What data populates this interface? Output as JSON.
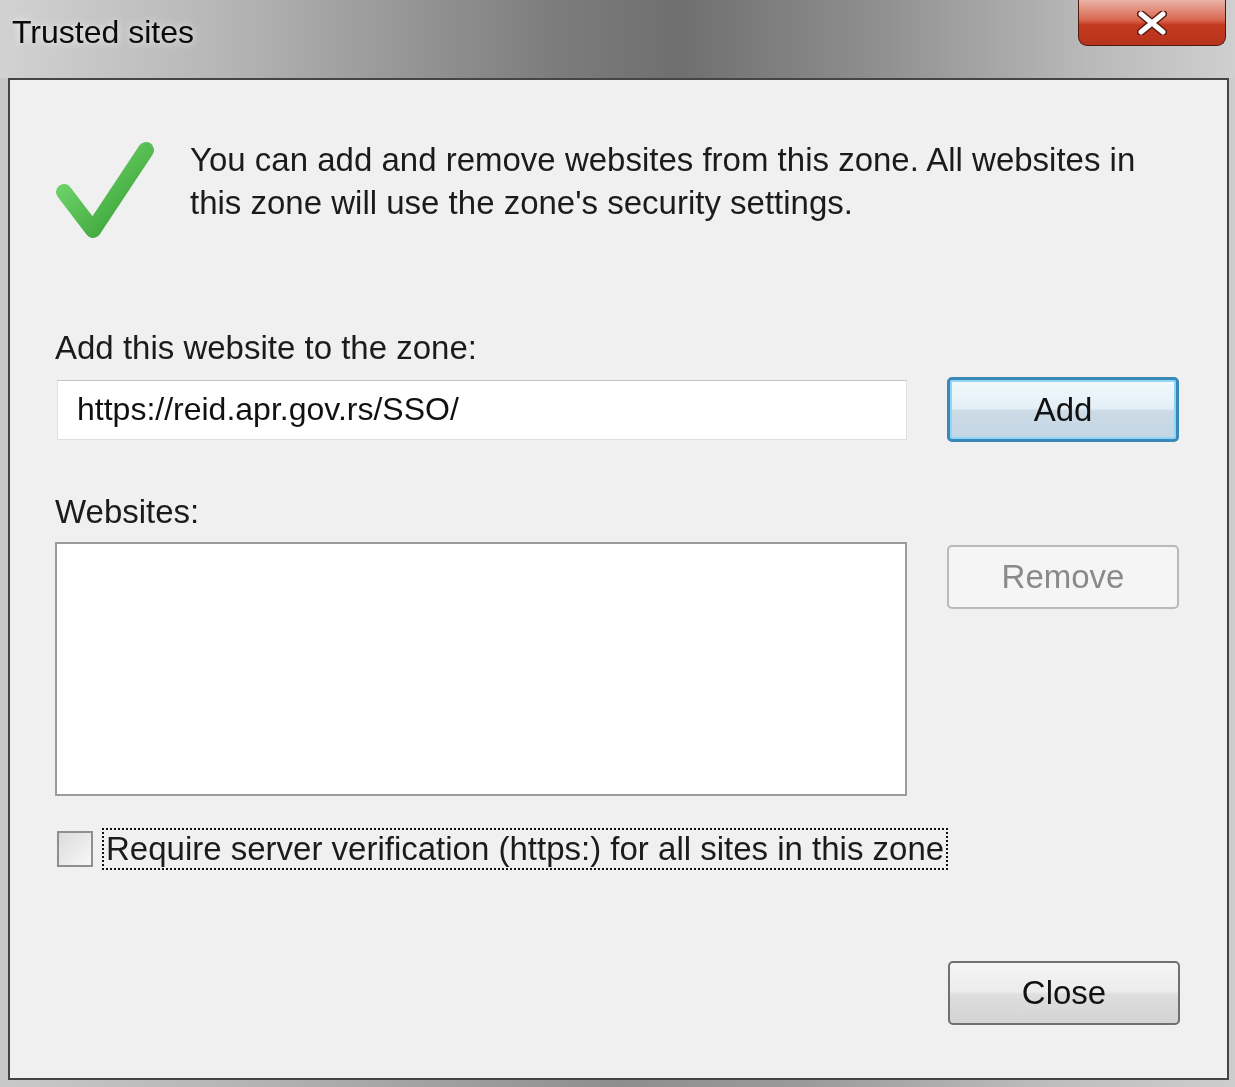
{
  "window": {
    "title": "Trusted sites"
  },
  "message": "You can add and remove websites from this zone. All websites in this zone will use the zone's security settings.",
  "add_site": {
    "label": "Add this website to the zone:",
    "value": "https://reid.apr.gov.rs/SSO/",
    "button": {
      "label": "Add",
      "default": true,
      "disabled": false
    }
  },
  "websites": {
    "label": "Websites:",
    "button": {
      "label": "Remove",
      "default": false,
      "disabled": true
    }
  },
  "require_https": {
    "label": "Require server verification (https:) for all sites in this zone",
    "checked": false,
    "focused": true
  },
  "close_button": {
    "label": "Close",
    "default": false,
    "disabled": false
  }
}
